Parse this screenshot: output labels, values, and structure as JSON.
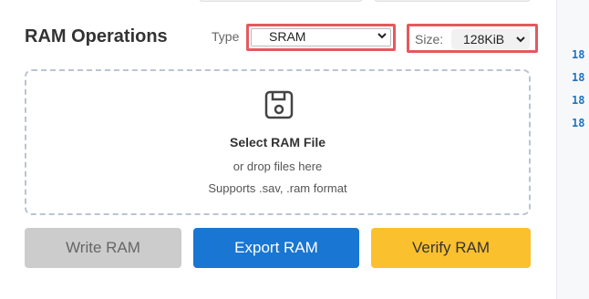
{
  "title": "RAM Operations",
  "type": {
    "label": "Type",
    "value": "SRAM"
  },
  "size": {
    "label": "Size:",
    "value": "128KiB"
  },
  "dropzone": {
    "icon": "save-icon",
    "title": "Select RAM File",
    "subtitle": "or drop files here",
    "formats": "Supports .sav, .ram format"
  },
  "buttons": {
    "write": "Write RAM",
    "export": "Export RAM",
    "verify": "Verify RAM"
  },
  "side_panel": {
    "lines": [
      "18",
      "18",
      "18",
      "18"
    ]
  },
  "colors": {
    "highlight": "#e35a5f",
    "export": "#1976d2",
    "verify": "#fbc02d",
    "write_disabled": "#cccccc",
    "code_text": "#1e73be"
  }
}
